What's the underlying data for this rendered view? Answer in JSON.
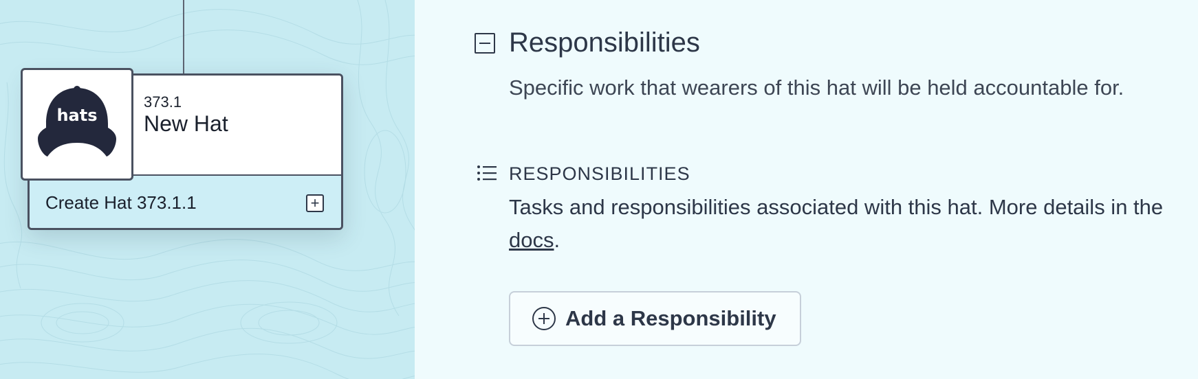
{
  "tree": {
    "hat": {
      "id": "373.1",
      "name": "New Hat",
      "image_text": "hats",
      "create_label": "Create Hat 373.1.1"
    }
  },
  "panel": {
    "section_title": "Responsibilities",
    "section_description": "Specific work that wearers of this hat will be held accountable for.",
    "sub_label": "RESPONSIBILITIES",
    "sub_description_prefix": "Tasks and responsibilities associated with this hat. More details in the ",
    "docs_link": "docs",
    "sub_description_suffix": ".",
    "add_button_label": "Add a Responsibility"
  },
  "colors": {
    "canvas_bg": "#c7ebf2",
    "panel_bg": "#effbfd",
    "hat_navy": "#23283c",
    "text": "#2d3748"
  },
  "icons": [
    "collapse-icon",
    "list-icon",
    "plus-circle-icon",
    "plus-square-icon",
    "hat-cap-icon"
  ]
}
